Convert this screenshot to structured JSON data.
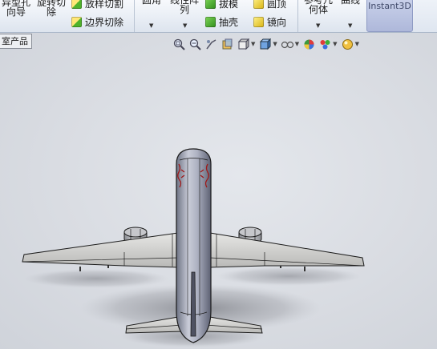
{
  "ribbon": {
    "hole_wizard_label": "异型孔\n向导",
    "revolved_cut_label": "旋转切\n除",
    "lofted_cut_label": "放样切割",
    "boundary_cut_label": "边界切除",
    "fillet_label": "圆角",
    "linear_pattern_label": "线性阵\n列",
    "draft_label": "拔模",
    "shell_label": "抽壳",
    "dome_label": "圆顶",
    "mirror_label": "镜向",
    "ref_geometry_label": "参考几\n何体",
    "curves_label": "曲线",
    "instant3d_label": "Instant3D"
  },
  "feature_tree": {
    "tab_label": "室产品"
  },
  "heads_up_toolbar": {
    "icons": [
      "zoom-to-fit-icon",
      "zoom-to-area-icon",
      "previous-view-icon",
      "section-view-icon",
      "view-orientation-icon",
      "display-style-icon",
      "hide-show-items-icon",
      "edit-appearance-icon",
      "apply-scene-icon",
      "view-settings-icon"
    ]
  },
  "colors": {
    "viewport_background": "#dadde3",
    "fuselage": "#a9adbd",
    "wing": "#d4d4d2",
    "edge": "#1c1c1c",
    "decal": "#a01818",
    "instant3d_highlight": "#b8c1e0"
  }
}
